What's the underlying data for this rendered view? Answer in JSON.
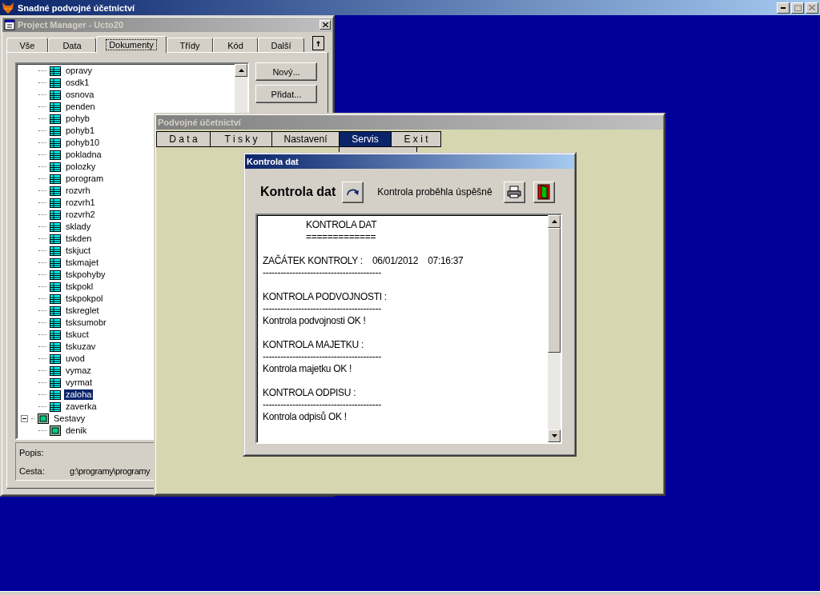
{
  "main_window": {
    "title": "Snadné podvojné účetnictví"
  },
  "project_manager": {
    "title": "Project Manager - Ucto20",
    "tabs": [
      {
        "label": "Vše",
        "selected": false
      },
      {
        "label": "Data",
        "selected": false
      },
      {
        "label": "Dokumenty",
        "selected": true
      },
      {
        "label": "Třídy",
        "selected": false
      },
      {
        "label": "Kód",
        "selected": false
      },
      {
        "label": "Další",
        "selected": false
      }
    ],
    "tree": [
      {
        "label": "opravy",
        "kind": "table",
        "selected": false
      },
      {
        "label": "osdk1",
        "kind": "table",
        "selected": false
      },
      {
        "label": "osnova",
        "kind": "table",
        "selected": false
      },
      {
        "label": "penden",
        "kind": "table",
        "selected": false
      },
      {
        "label": "pohyb",
        "kind": "table",
        "selected": false
      },
      {
        "label": "pohyb1",
        "kind": "table",
        "selected": false
      },
      {
        "label": "pohyb10",
        "kind": "table",
        "selected": false
      },
      {
        "label": "pokladna",
        "kind": "table",
        "selected": false
      },
      {
        "label": "polozky",
        "kind": "table",
        "selected": false
      },
      {
        "label": "porogram",
        "kind": "table",
        "selected": false
      },
      {
        "label": "rozvrh",
        "kind": "table",
        "selected": false
      },
      {
        "label": "rozvrh1",
        "kind": "table",
        "selected": false
      },
      {
        "label": "rozvrh2",
        "kind": "table",
        "selected": false
      },
      {
        "label": "sklady",
        "kind": "table",
        "selected": false
      },
      {
        "label": "tskden",
        "kind": "table",
        "selected": false
      },
      {
        "label": "tskjuct",
        "kind": "table",
        "selected": false
      },
      {
        "label": "tskmajet",
        "kind": "table",
        "selected": false
      },
      {
        "label": "tskpohyby",
        "kind": "table",
        "selected": false
      },
      {
        "label": "tskpokl",
        "kind": "table",
        "selected": false
      },
      {
        "label": "tskpokpol",
        "kind": "table",
        "selected": false
      },
      {
        "label": "tskreglet",
        "kind": "table",
        "selected": false
      },
      {
        "label": "tsksumobr",
        "kind": "table",
        "selected": false
      },
      {
        "label": "tskuct",
        "kind": "table",
        "selected": false
      },
      {
        "label": "tskuzav",
        "kind": "table",
        "selected": false
      },
      {
        "label": "uvod",
        "kind": "table",
        "selected": false
      },
      {
        "label": "vymaz",
        "kind": "table",
        "selected": false
      },
      {
        "label": "vyrmat",
        "kind": "table",
        "selected": false
      },
      {
        "label": "zaloha",
        "kind": "table",
        "selected": true
      },
      {
        "label": "zaverka",
        "kind": "table",
        "selected": false
      },
      {
        "label": "Sestavy",
        "kind": "group",
        "expanded": true,
        "selected": false,
        "children": [
          {
            "label": "denik",
            "kind": "report",
            "selected": false
          }
        ]
      }
    ],
    "buttons": [
      "Nový...",
      "Přidat..."
    ],
    "info": [
      {
        "label": "Popis:"
      },
      {
        "label": "Cesta:",
        "value": "g:\\programy\\programy"
      }
    ]
  },
  "app_window": {
    "title": "Podvojné účetnictví",
    "menu": [
      {
        "label": "D a t a",
        "selected": false
      },
      {
        "label": "T i s k y",
        "selected": false
      },
      {
        "label": "Nastavení",
        "selected": false
      },
      {
        "label": "Servis",
        "selected": true
      },
      {
        "label": "E x i t",
        "selected": false
      }
    ]
  },
  "dialog": {
    "title": "Kontrola dat",
    "heading": "Kontrola dat",
    "status": "Kontrola proběhla úspěšně",
    "log_heading": [
      "KONTROLA DAT",
      "============="
    ],
    "log": [
      [
        "ZAČÁTEK KONTROLY :    06/01/2012    07:16:37",
        "----------------------------------------"
      ],
      [
        "KONTROLA PODVOJNOSTI :",
        "----------------------------------------",
        "Kontrola podvojnosti OK !"
      ],
      [
        "KONTROLA MAJETKU :",
        "----------------------------------------",
        "Kontrola majetku OK !"
      ],
      [
        "KONTROLA ODPISU :",
        "----------------------------------------",
        "Kontrola odpisů OK !"
      ]
    ]
  }
}
